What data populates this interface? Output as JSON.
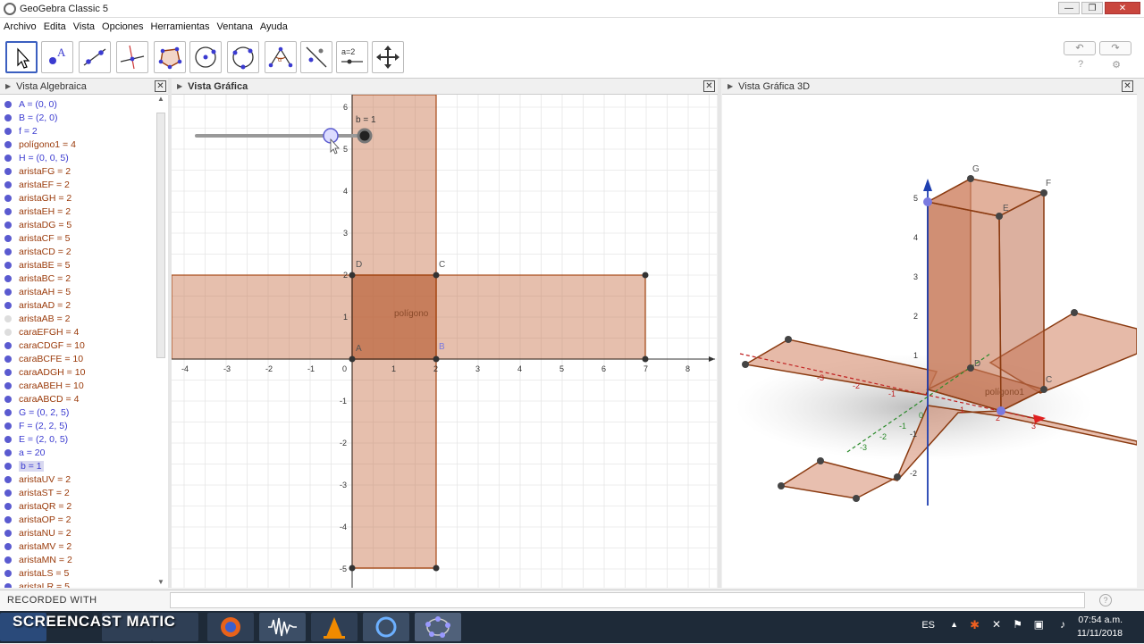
{
  "window": {
    "title": "GeoGebra Classic 5",
    "minimize": "—",
    "maximize": "❐",
    "close": "✕"
  },
  "menu": [
    "Archivo",
    "Edita",
    "Vista",
    "Opciones",
    "Herramientas",
    "Ventana",
    "Ayuda"
  ],
  "toolbar": {
    "tools": [
      "move-tool",
      "point-tool",
      "line-tool",
      "perpendicular-line-tool",
      "polygon-tool",
      "circle-tool",
      "circle-through-points-tool",
      "angle-tool",
      "reflect-tool",
      "slider-tool",
      "move-graphics-view-tool"
    ],
    "slider_label": "a=2",
    "undo": "↶",
    "redo": "↷",
    "help_icon": "?",
    "settings_icon": "⚙"
  },
  "panels": {
    "algebra_title": "Vista Algebraica",
    "graphics_title": "Vista Gráfica",
    "graphics3d_title": "Vista Gráfica 3D",
    "close_symbol": "✕"
  },
  "algebra_items": [
    {
      "text": "A = (0, 0)",
      "color": "#3b3bd0"
    },
    {
      "text": "B = (2, 0)",
      "color": "#3b3bd0"
    },
    {
      "text": "f = 2",
      "color": "#3b3bd0"
    },
    {
      "text": "polígono1 = 4",
      "color": "#9a3a0a"
    },
    {
      "text": "H = (0, 0, 5)",
      "color": "#3b3bd0"
    },
    {
      "text": "aristaFG = 2",
      "color": "#9a3a0a"
    },
    {
      "text": "aristaEF = 2",
      "color": "#9a3a0a"
    },
    {
      "text": "aristaGH = 2",
      "color": "#9a3a0a"
    },
    {
      "text": "aristaEH = 2",
      "color": "#9a3a0a"
    },
    {
      "text": "aristaDG = 5",
      "color": "#9a3a0a"
    },
    {
      "text": "aristaCF = 5",
      "color": "#9a3a0a"
    },
    {
      "text": "aristaCD = 2",
      "color": "#9a3a0a"
    },
    {
      "text": "aristaBE = 5",
      "color": "#9a3a0a"
    },
    {
      "text": "aristaBC = 2",
      "color": "#9a3a0a"
    },
    {
      "text": "aristaAH = 5",
      "color": "#9a3a0a"
    },
    {
      "text": "aristaAD = 2",
      "color": "#9a3a0a"
    },
    {
      "text": "aristaAB = 2",
      "color": "#9a3a0a"
    },
    {
      "text": "caraEFGH = 4",
      "color": "#9a3a0a"
    },
    {
      "text": "caraCDGF = 10",
      "color": "#9a3a0a"
    },
    {
      "text": "caraBCFE = 10",
      "color": "#9a3a0a"
    },
    {
      "text": "caraADGH = 10",
      "color": "#9a3a0a"
    },
    {
      "text": "caraABEH = 10",
      "color": "#9a3a0a"
    },
    {
      "text": "caraABCD = 4",
      "color": "#9a3a0a"
    },
    {
      "text": "G = (0, 2, 5)",
      "color": "#3b3bd0"
    },
    {
      "text": "F = (2, 2, 5)",
      "color": "#3b3bd0"
    },
    {
      "text": "E = (2, 0, 5)",
      "color": "#3b3bd0"
    },
    {
      "text": "a = 20",
      "color": "#3b3bd0"
    },
    {
      "text": "b = 1",
      "color": "#3b3bd0"
    },
    {
      "text": "aristaUV = 2",
      "color": "#9a3a0a"
    },
    {
      "text": "aristaST = 2",
      "color": "#9a3a0a"
    },
    {
      "text": "aristaQR = 2",
      "color": "#9a3a0a"
    },
    {
      "text": "aristaOP = 2",
      "color": "#9a3a0a"
    },
    {
      "text": "aristaNU = 2",
      "color": "#9a3a0a"
    },
    {
      "text": "aristaMV = 2",
      "color": "#9a3a0a"
    },
    {
      "text": "aristaMN = 2",
      "color": "#9a3a0a"
    },
    {
      "text": "aristaLS = 5",
      "color": "#9a3a0a"
    },
    {
      "text": "aristaLR = 5",
      "color": "#9a3a0a"
    }
  ],
  "graphics2d": {
    "slider_label": "b = 1",
    "polygon_label": "polígono",
    "points": {
      "A": "A",
      "B": "B",
      "C": "C",
      "D": "D"
    },
    "x_ticks": [
      "-4",
      "-3",
      "-2",
      "-1",
      "0",
      "1",
      "2",
      "3",
      "4",
      "5",
      "6",
      "7",
      "8"
    ],
    "y_ticks": [
      "6",
      "5",
      "4",
      "3",
      "2",
      "1",
      "-1",
      "-2",
      "-3",
      "-4",
      "-5"
    ]
  },
  "graphics3d": {
    "labels": {
      "G": "G",
      "F": "F",
      "E": "E",
      "C": "C",
      "D": "D",
      "polygon": "polígono1"
    },
    "z_ticks": [
      "5",
      "4",
      "3",
      "2",
      "1",
      "-1",
      "-2"
    ],
    "x_ticks": [
      "-3",
      "-2",
      "-1",
      "1",
      "2",
      "3"
    ],
    "y_ticks": [
      "-3",
      "-2",
      "-1",
      "0"
    ]
  },
  "status": {
    "recorded": "RECORDED WITH",
    "help": "?"
  },
  "taskbar": {
    "brand": "SCREENCAST MATIC",
    "language": "ES",
    "time": "07:54 a.m.",
    "date": "11/11/2018"
  }
}
